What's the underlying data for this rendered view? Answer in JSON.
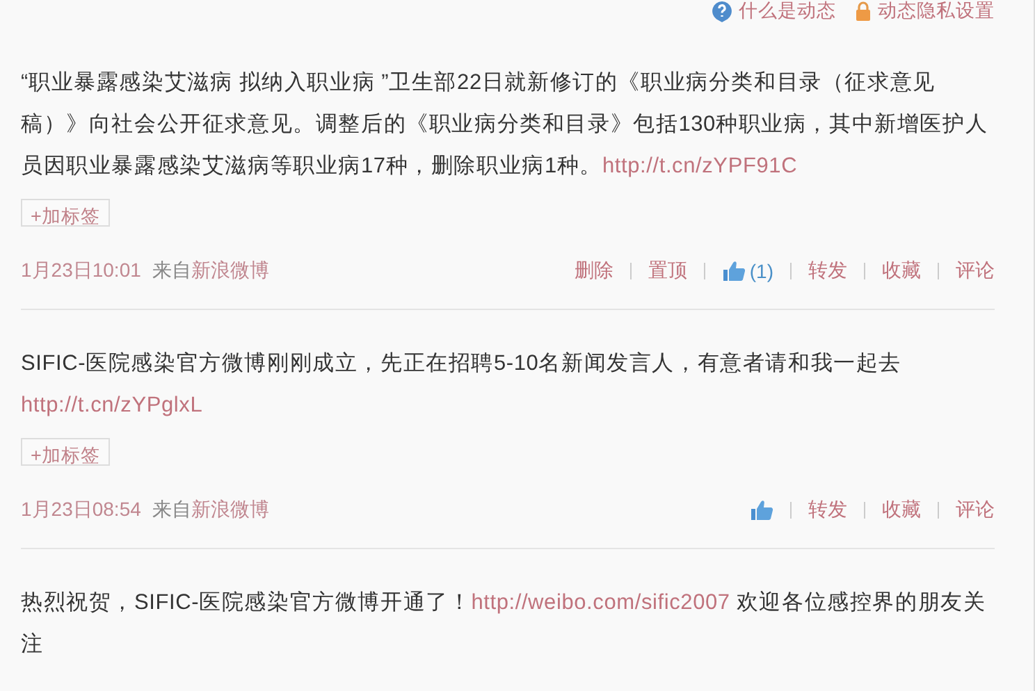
{
  "top_links": [
    {
      "kind": "help",
      "label": "什么是动态"
    },
    {
      "kind": "lock",
      "label": "动态隐私设置"
    }
  ],
  "posts": [
    {
      "segments": [
        {
          "kind": "text",
          "text": "“职业暴露感染艾滋病 拟纳入职业病 ”卫生部22日就新修订的《职业病分类和目录（征求意见稿）》向社会公开征求意见。调整后的《职业病分类和目录》包括130种职业病，其中新增医护人员因职业暴露感染艾滋病等职业病17种，删除职业病1种。"
        },
        {
          "kind": "link",
          "text": "http://t.cn/zYPF91C"
        }
      ],
      "tag_button": "+加标签",
      "time": "1月23日10:01",
      "source_prefix": "来自",
      "source": "新浪微博",
      "actions": [
        {
          "kind": "text",
          "label": "删除"
        },
        {
          "kind": "text",
          "label": "置顶"
        },
        {
          "kind": "like",
          "label": "(1)"
        },
        {
          "kind": "text",
          "label": "转发"
        },
        {
          "kind": "text",
          "label": "收藏"
        },
        {
          "kind": "text",
          "label": "评论"
        }
      ]
    },
    {
      "segments": [
        {
          "kind": "text",
          "text": "SIFIC-医院感染官方微博刚刚成立，先正在招聘5-10名新闻发言人，有意者请和我一起去 "
        },
        {
          "kind": "link",
          "text": "http://t.cn/zYPglxL"
        }
      ],
      "tag_button": "+加标签",
      "time": "1月23日08:54",
      "source_prefix": "来自",
      "source": "新浪微博",
      "actions": [
        {
          "kind": "like"
        },
        {
          "kind": "text",
          "label": "转发"
        },
        {
          "kind": "text",
          "label": "收藏"
        },
        {
          "kind": "text",
          "label": "评论"
        }
      ]
    },
    {
      "segments": [
        {
          "kind": "text",
          "text": "热烈祝贺，SIFIC-医院感染官方微博开通了！"
        },
        {
          "kind": "link",
          "text": "http://weibo.com/sific2007"
        },
        {
          "kind": "text",
          "text": " 欢迎各位感控界的朋友关注"
        }
      ]
    }
  ]
}
